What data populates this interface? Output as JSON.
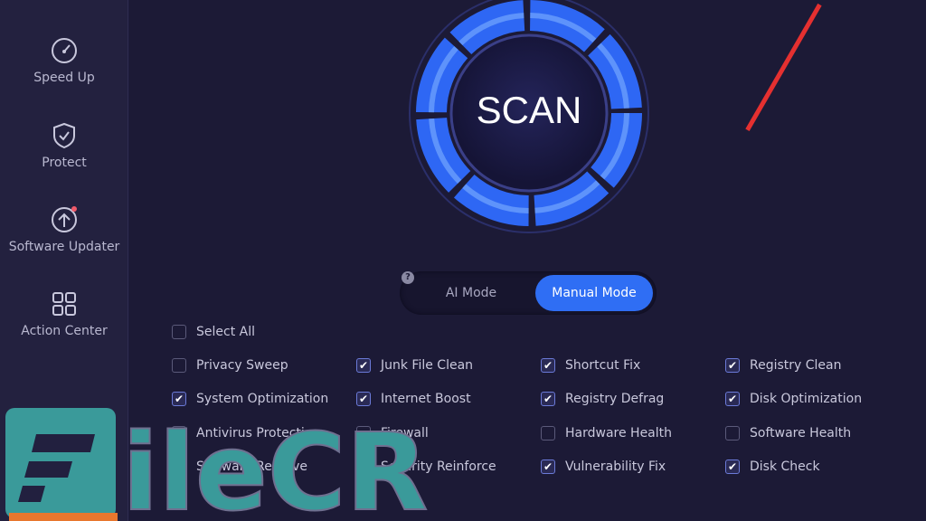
{
  "sidebar": {
    "items": [
      {
        "label": "Speed Up",
        "icon": "speedometer-icon"
      },
      {
        "label": "Protect",
        "icon": "shield-check-icon"
      },
      {
        "label": "Software Updater",
        "icon": "upload-arrow-icon",
        "badge": true
      },
      {
        "label": "Action Center",
        "icon": "grid-icon"
      }
    ]
  },
  "scan": {
    "label": "SCAN"
  },
  "modes": {
    "help": "?",
    "ai": "AI Mode",
    "manual": "Manual Mode",
    "selected": "Manual Mode"
  },
  "select_all": {
    "label": "Select All",
    "checked": false
  },
  "options": [
    {
      "label": "Privacy Sweep",
      "checked": false
    },
    {
      "label": "Junk File Clean",
      "checked": true
    },
    {
      "label": "Shortcut Fix",
      "checked": true
    },
    {
      "label": "Registry Clean",
      "checked": true
    },
    {
      "label": "System Optimization",
      "checked": true
    },
    {
      "label": "Internet Boost",
      "checked": true
    },
    {
      "label": "Registry Defrag",
      "checked": true
    },
    {
      "label": "Disk Optimization",
      "checked": true
    },
    {
      "label": "Antivirus Protection",
      "checked": false
    },
    {
      "label": "Firewall",
      "checked": false
    },
    {
      "label": "Hardware Health",
      "checked": false
    },
    {
      "label": "Software Health",
      "checked": false
    },
    {
      "label": "Software Remove",
      "checked": false
    },
    {
      "label": "Security Reinforce",
      "checked": false
    },
    {
      "label": "Vulnerability Fix",
      "checked": true
    },
    {
      "label": "Disk Check",
      "checked": true
    }
  ],
  "watermark": "FileCR",
  "colors": {
    "accent": "#2f6ef4",
    "background": "#1c1a36",
    "watermark": "#3a9a9a"
  }
}
